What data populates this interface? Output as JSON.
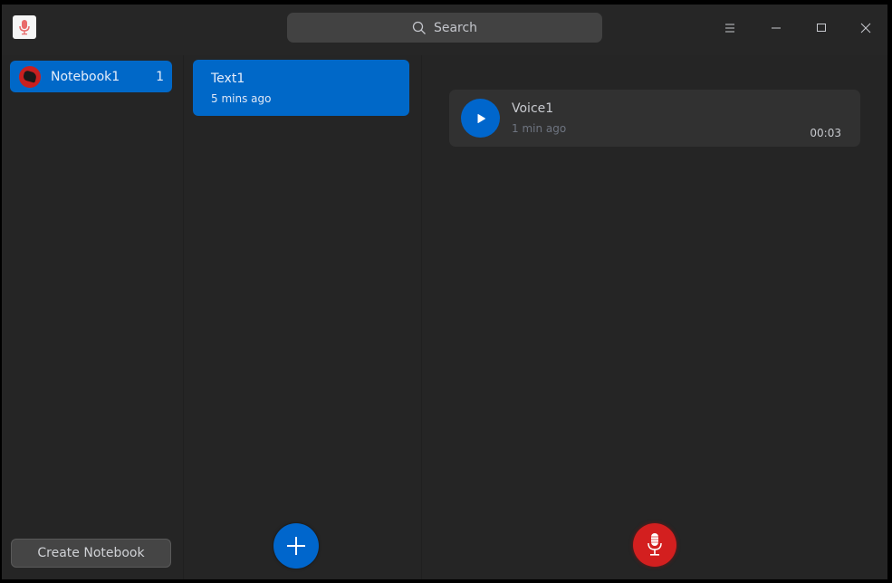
{
  "titlebar": {
    "search_placeholder": "Search",
    "icons": {
      "app": "voice-notes-app-icon",
      "search": "search-icon",
      "menu": "hamburger-menu-icon",
      "minimize": "minimize-icon",
      "maximize": "maximize-icon",
      "close": "close-icon"
    }
  },
  "sidebar": {
    "notebooks": [
      {
        "name": "Notebook1",
        "count": "1",
        "selected": true
      }
    ],
    "create_button_label": "Create Notebook"
  },
  "notes_list": {
    "items": [
      {
        "title": "Text1",
        "time": "5 mins ago",
        "selected": true
      }
    ],
    "add_button_icon": "plus-icon"
  },
  "detail": {
    "voice_items": [
      {
        "title": "Voice1",
        "time": "1 min ago",
        "duration": "00:03"
      }
    ],
    "record_button_icon": "microphone-icon"
  },
  "colors": {
    "accent": "#0068c8",
    "record": "#d31f1f",
    "background": "#252525",
    "card": "#313131"
  }
}
